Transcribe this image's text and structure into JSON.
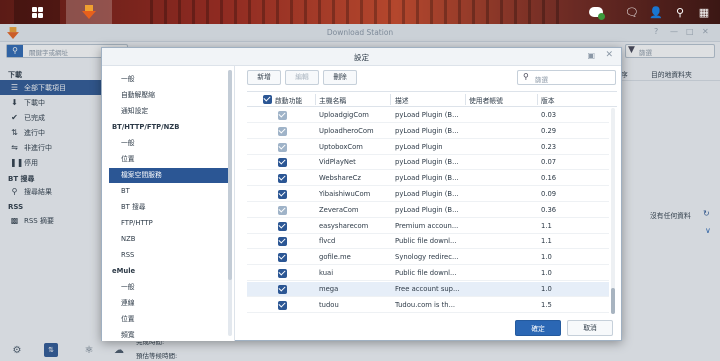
{
  "taskbar": {
    "tray_icons": [
      "sync-status-icon",
      "message-icon",
      "user-icon",
      "search-icon",
      "widgets-icon"
    ]
  },
  "window": {
    "title": "Download Station",
    "search_placeholder": "關鍵字或網址",
    "filter_placeholder": "篩選",
    "sidebar": {
      "sections": [
        {
          "header": "下載",
          "items": [
            {
              "label": "全部下載項目",
              "icon": "list-icon",
              "active": true
            },
            {
              "label": "下載中",
              "icon": "download-arrow-icon"
            },
            {
              "label": "已完成",
              "icon": "check-icon"
            },
            {
              "label": "進行中",
              "icon": "transfer-icon"
            },
            {
              "label": "非進行中",
              "icon": "inactive-icon"
            },
            {
              "label": "停用",
              "icon": "pause-icon"
            }
          ]
        },
        {
          "header": "BT 搜尋",
          "items": [
            {
              "label": "搜尋結果",
              "icon": "search-icon"
            }
          ]
        },
        {
          "header": "RSS",
          "items": [
            {
              "label": "RSS 摘要",
              "icon": "rss-icon"
            }
          ]
        }
      ]
    },
    "list_columns": [
      "序",
      "目的地資料夾"
    ],
    "no_data": "沒有任何資料",
    "detail_labels": [
      "完成時間:",
      "預估等候時間:"
    ],
    "bottom_icons": [
      "settings-gear-icon",
      "task-list-icon",
      "emule-icon",
      "bt-icon"
    ]
  },
  "dialog": {
    "title": "設定",
    "nav": [
      {
        "label": "一般",
        "kind": "item"
      },
      {
        "label": "自動解壓縮",
        "kind": "item"
      },
      {
        "label": "通知設定",
        "kind": "item"
      },
      {
        "label": "BT/HTTP/FTP/NZB",
        "kind": "head"
      },
      {
        "label": "一般",
        "kind": "item"
      },
      {
        "label": "位置",
        "kind": "item"
      },
      {
        "label": "檔案空間服務",
        "kind": "item",
        "selected": true
      },
      {
        "label": "BT",
        "kind": "item"
      },
      {
        "label": "BT 搜尋",
        "kind": "item"
      },
      {
        "label": "FTP/HTTP",
        "kind": "item"
      },
      {
        "label": "NZB",
        "kind": "item"
      },
      {
        "label": "RSS",
        "kind": "item"
      },
      {
        "label": "eMule",
        "kind": "head"
      },
      {
        "label": "一般",
        "kind": "item"
      },
      {
        "label": "連線",
        "kind": "item"
      },
      {
        "label": "位置",
        "kind": "item"
      },
      {
        "label": "頻寬",
        "kind": "item"
      }
    ],
    "toolbar": {
      "add": "新增",
      "edit": "編輯",
      "delete": "刪除",
      "search_placeholder": "篩選"
    },
    "table": {
      "headers": [
        "啟動功能",
        "主機名稱",
        "描述",
        "使用者帳號",
        "版本"
      ],
      "rows": [
        {
          "enabled": "grey",
          "host": "UploadgigCom",
          "desc": "pyLoad Plugin (B...",
          "user": "",
          "version": "0.03"
        },
        {
          "enabled": "grey",
          "host": "UploadheroCom",
          "desc": "pyLoad Plugin (B...",
          "user": "",
          "version": "0.29"
        },
        {
          "enabled": "grey",
          "host": "UptoboxCom",
          "desc": "pyLoad Plugin",
          "user": "",
          "version": "0.23"
        },
        {
          "enabled": "blue",
          "host": "VidPlayNet",
          "desc": "pyLoad Plugin (B...",
          "user": "",
          "version": "0.07"
        },
        {
          "enabled": "blue",
          "host": "WebshareCz",
          "desc": "pyLoad Plugin (B...",
          "user": "",
          "version": "0.16"
        },
        {
          "enabled": "blue",
          "host": "YibaishiwuCom",
          "desc": "pyLoad Plugin (B...",
          "user": "",
          "version": "0.09"
        },
        {
          "enabled": "grey",
          "host": "ZeveraCom",
          "desc": "pyLoad Plugin (B...",
          "user": "",
          "version": "0.36"
        },
        {
          "enabled": "blue",
          "host": "easysharecom",
          "desc": "Premium accoun...",
          "user": "",
          "version": "1.1"
        },
        {
          "enabled": "blue",
          "host": "flvcd",
          "desc": "Public file downl...",
          "user": "",
          "version": "1.1"
        },
        {
          "enabled": "blue",
          "host": "gofile.me",
          "desc": "Synology redirec...",
          "user": "",
          "version": "1.0"
        },
        {
          "enabled": "blue",
          "host": "kuai",
          "desc": "Public file downl...",
          "user": "",
          "version": "1.0"
        },
        {
          "enabled": "blue",
          "host": "mega",
          "desc": "Free account sup...",
          "user": "",
          "version": "1.0",
          "highlight": true
        },
        {
          "enabled": "blue",
          "host": "tudou",
          "desc": "Tudou.com is th...",
          "user": "",
          "version": "1.5"
        }
      ]
    },
    "ok": "確定",
    "cancel": "取消"
  }
}
